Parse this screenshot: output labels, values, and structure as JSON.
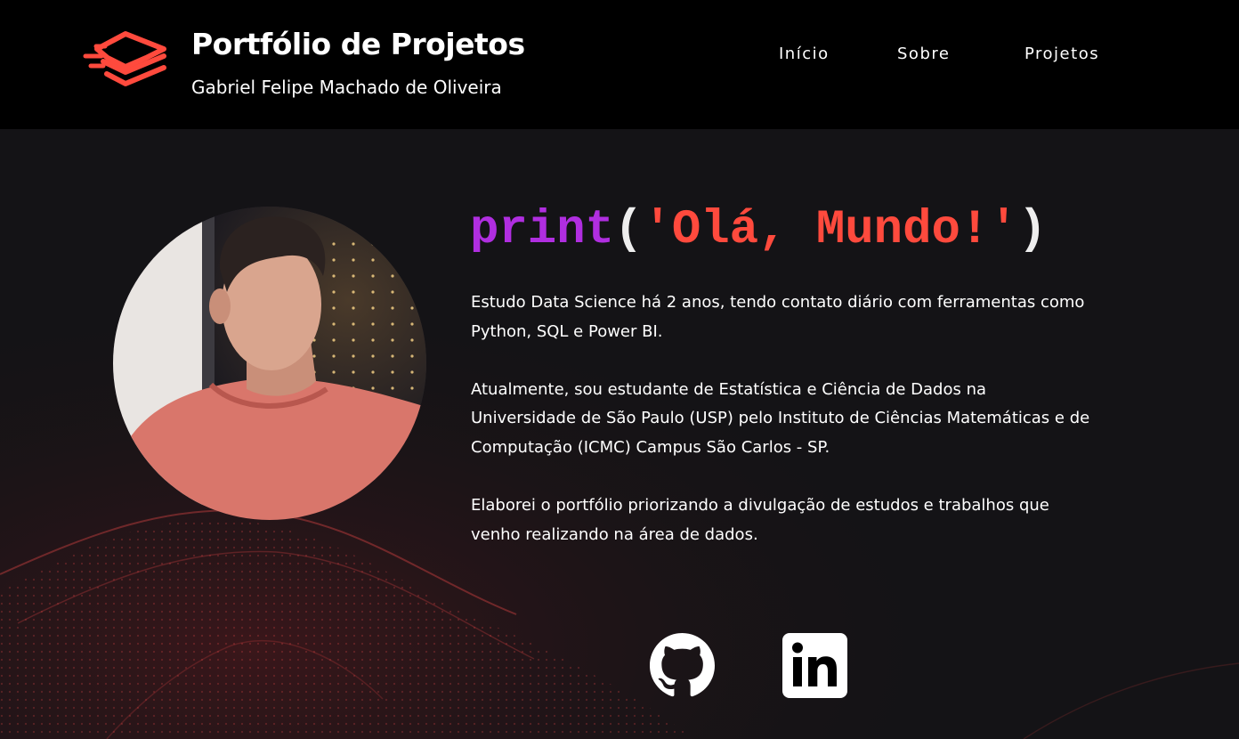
{
  "header": {
    "title": "Portfólio de Projetos",
    "subtitle": "Gabriel Felipe Machado de Oliveira",
    "logo_icon": "stacked-layers-icon"
  },
  "nav": {
    "items": [
      {
        "label": "Início"
      },
      {
        "label": "Sobre"
      },
      {
        "label": "Projetos"
      }
    ]
  },
  "hero": {
    "code": {
      "fn": "print",
      "open": "(",
      "string": "'Olá, Mundo!'",
      "close": ")"
    },
    "paragraphs": [
      "Estudo Data Science há 2 anos, tendo contato diário com ferramentas como Python, SQL e Power BI.",
      "Atualmente, sou estudante de Estatística e Ciência de Dados na Universidade de São Paulo (USP) pelo Instituto de Ciências Matemáticas e de Computação (ICMC) Campus São Carlos - SP.",
      "Elaborei o portfólio priorizando a divulgação de estudos e trabalhos que venho realizando na área de dados."
    ]
  },
  "social": {
    "github_icon": "github-icon",
    "linkedin_icon": "linkedin-icon"
  },
  "colors": {
    "accent": "#ff4a3d",
    "code_function": "#b02ee0",
    "header_bg": "#000000",
    "page_bg": "#141316"
  }
}
